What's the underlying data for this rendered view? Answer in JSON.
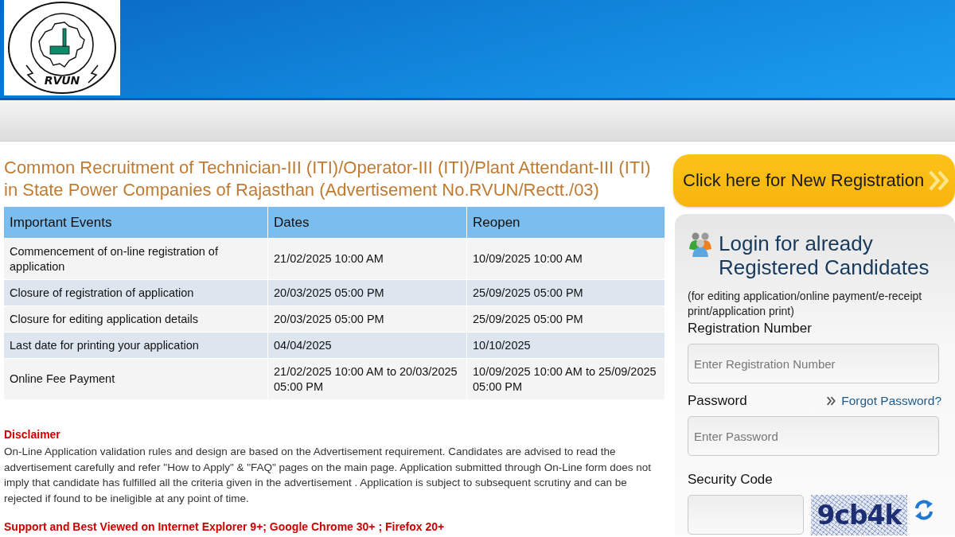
{
  "header": {
    "logo_text": "RVUN"
  },
  "title": "Common Recruitment of Technician-III (ITI)/Operator-III (ITI)/Plant Attendant-III (ITI) in State Power Companies of Rajasthan (Advertisement No.RVUN/Rectt./03)",
  "events_table": {
    "columns": [
      "Important Events",
      "Dates",
      "Reopen"
    ],
    "rows": [
      [
        "Commencement of on-line registration of application",
        "21/02/2025 10:00 AM",
        "10/09/2025 10:00 AM"
      ],
      [
        "Closure of registration of application",
        "20/03/2025 05:00 PM",
        "25/09/2025 05:00 PM"
      ],
      [
        "Closure for editing application details",
        "20/03/2025 05:00 PM",
        "25/09/2025 05:00 PM"
      ],
      [
        "Last date for printing your application",
        "04/04/2025",
        "10/10/2025"
      ],
      [
        "Online Fee Payment",
        "21/02/2025 10:00 AM to 20/03/2025 05:00 PM",
        "10/09/2025 10:00 AM to 25/09/2025 05:00 PM"
      ]
    ]
  },
  "disclaimer": {
    "heading": "Disclaimer",
    "text": "On-Line Application validation rules and design are based on the Advertisement requirement. Candidates are advised to read the advertisement carefully and refer \"How to Apply\" & \"FAQ\" pages on the main page. Application submitted through On-Line form does not imply that candidate has fulfilled all the criteria given in the advertisement . Application is subject to subsequent scrutiny and can be rejected if found to be ineligible at any point of time."
  },
  "browser_note": "Support and Best Viewed on Internet Explorer 9+; Google Chrome 30+ ; Firefox 20+",
  "new_registration_button": "Click here for New Registration",
  "login": {
    "title": "Login for already Registered Candidates",
    "note": "(for editing application/online payment/e-receipt print/application print)",
    "fields": [
      {
        "label": "Registration Number",
        "placeholder": "Enter Registration Number"
      },
      {
        "label": "Password",
        "placeholder": "Enter Password"
      }
    ],
    "forgot_link": "Forgot Password?",
    "security_label": "Security Code",
    "captcha_text": "9cb4k"
  }
}
